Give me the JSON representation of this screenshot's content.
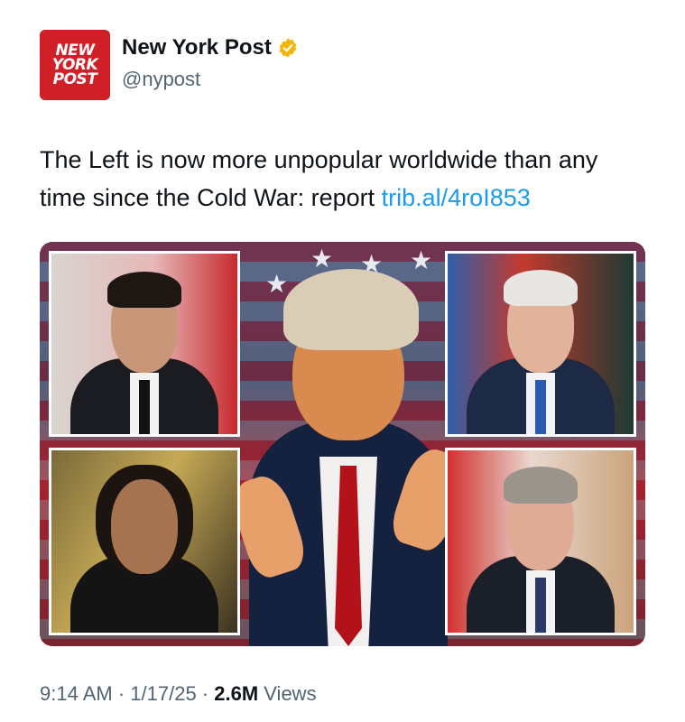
{
  "account": {
    "name": "New York Post",
    "handle": "@nypost",
    "avatar_lines": [
      "NEW",
      "YORK",
      "POST"
    ],
    "verified": true,
    "verified_icon": "verified-badge-icon",
    "avatar_color": "#d11f28",
    "verified_color": "#f4b400"
  },
  "tweet": {
    "text": "The Left is now more unpopular worldwide than any time since the Cold War: report ",
    "link_text": "trib.al/4roI853",
    "link_color": "#1d9bf0"
  },
  "meta": {
    "time": "9:14 AM",
    "separator": " · ",
    "date": "1/17/25",
    "views_count": "2.6M",
    "views_label": " Views"
  }
}
